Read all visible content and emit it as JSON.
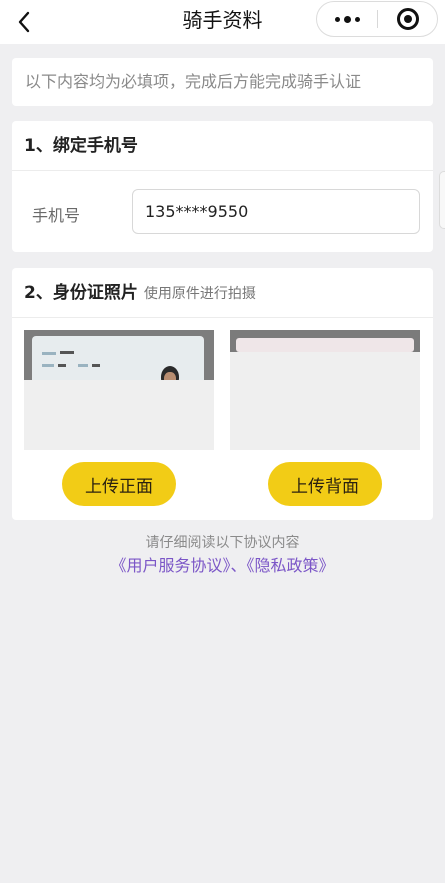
{
  "header": {
    "title": "骑手资料"
  },
  "notice": {
    "text": "以下内容均为必填项，完成后方能完成骑手认证"
  },
  "phone_section": {
    "title": "1、绑定手机号",
    "field_label": "手机号",
    "field_value": "135****9550"
  },
  "id_section": {
    "title": "2、身份证照片",
    "hint": "使用原件进行拍摄",
    "upload_front_label": "上传正面",
    "upload_back_label": "上传背面"
  },
  "agreement": {
    "note": "请仔细阅读以下协议内容",
    "link_service": "《用户服务协议》",
    "separator": "、",
    "link_privacy": "《隐私政策》"
  },
  "icons": {
    "back": "chevron-left-icon",
    "more": "more-dots-icon",
    "close": "target-circle-icon"
  },
  "colors": {
    "accent": "#f2cc16",
    "link": "#7b56c7",
    "background": "#efeff1"
  }
}
